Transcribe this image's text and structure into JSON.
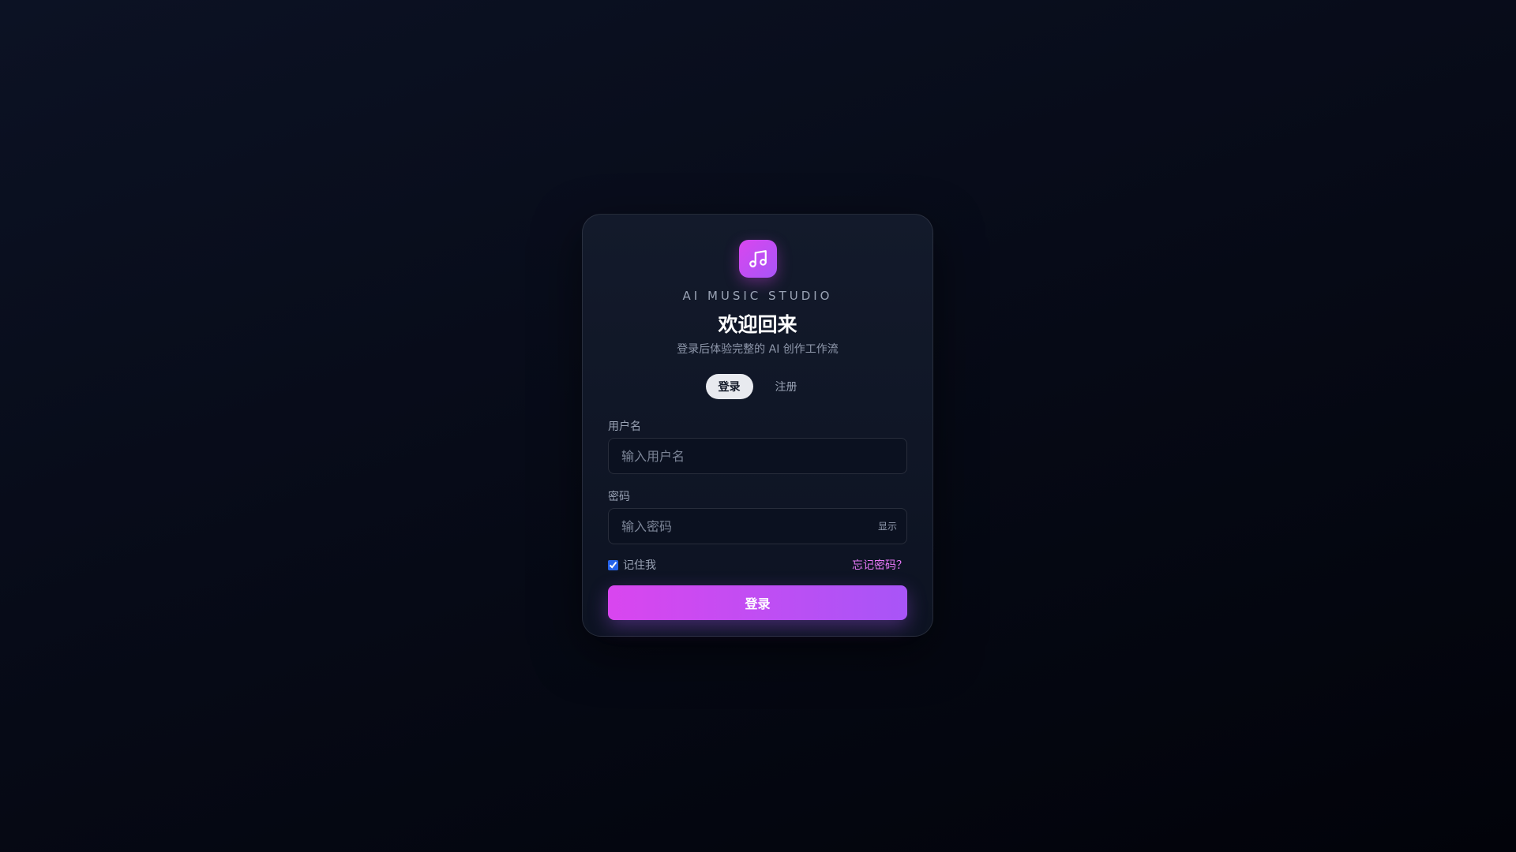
{
  "brand": {
    "name": "AI MUSIC STUDIO",
    "logo_icon": "music-note-icon"
  },
  "header": {
    "title": "欢迎回来",
    "subtitle": "登录后体验完整的 AI 创作工作流"
  },
  "tabs": [
    {
      "label": "登录",
      "active": true
    },
    {
      "label": "注册",
      "active": false
    }
  ],
  "form": {
    "username": {
      "label": "用户名",
      "placeholder": "输入用户名",
      "value": ""
    },
    "password": {
      "label": "密码",
      "placeholder": "输入密码",
      "value": "",
      "toggle_label": "显示"
    },
    "remember_label": "记住我",
    "remember_checked": true,
    "forgot_label": "忘记密码？",
    "submit_label": "登录"
  },
  "colors": {
    "accent_start": "#d946ef",
    "accent_end": "#a855f7",
    "link": "#e879f9"
  }
}
